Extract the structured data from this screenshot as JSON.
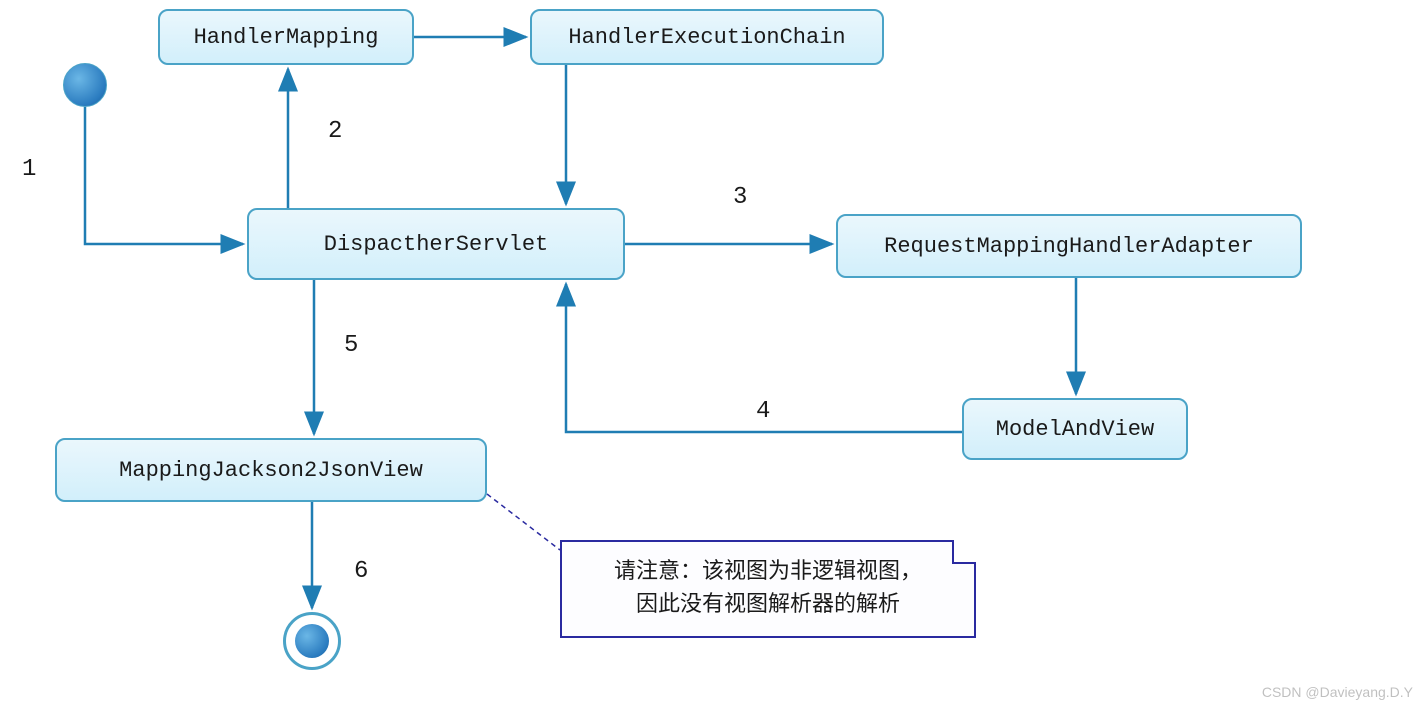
{
  "nodes": {
    "handlerMapping": "HandlerMapping",
    "handlerExecutionChain": "HandlerExecutionChain",
    "dispatcherServlet": "DispactherServlet",
    "requestMappingHandlerAdapter": "RequestMappingHandlerAdapter",
    "modelAndView": "ModelAndView",
    "mappingJacksonView": "MappingJackson2JsonView"
  },
  "edgeLabels": {
    "e1": "1",
    "e2": "2",
    "e3": "3",
    "e4": "4",
    "e5": "5",
    "e6": "6"
  },
  "note": {
    "line1": "请注意：该视图为非逻辑视图，",
    "line2": "因此没有视图解析器的解析"
  },
  "watermark": "CSDN @Davieyang.D.Y",
  "colors": {
    "nodeBorder": "#4aa3c7",
    "arrow": "#1f7db3",
    "noteBorder": "#2a2aa0"
  }
}
